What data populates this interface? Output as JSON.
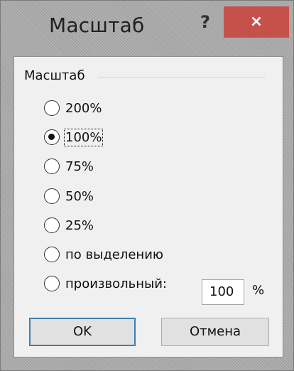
{
  "dialog": {
    "title": "Масштаб",
    "help_label": "?",
    "close_label": "×"
  },
  "group": {
    "label": "Масштаб"
  },
  "options": [
    {
      "label": "200%",
      "selected": false
    },
    {
      "label": "100%",
      "selected": true
    },
    {
      "label": "75%",
      "selected": false
    },
    {
      "label": "50%",
      "selected": false
    },
    {
      "label": "25%",
      "selected": false
    },
    {
      "label": "по выделению",
      "selected": false
    },
    {
      "label": "произвольный:",
      "selected": false
    }
  ],
  "custom": {
    "value": "100",
    "unit": "%"
  },
  "buttons": {
    "ok": "OK",
    "cancel": "Отмена"
  }
}
